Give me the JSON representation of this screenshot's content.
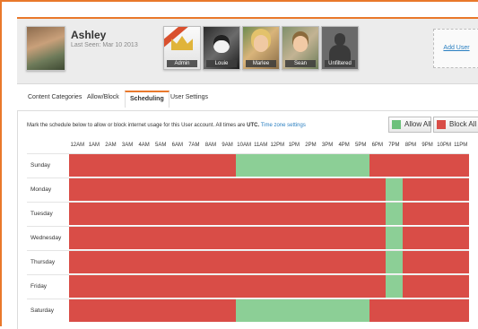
{
  "user": {
    "name": "Ashley",
    "last_seen": "Last Seen: Mar 10 2013"
  },
  "profiles": [
    {
      "label": "Admin",
      "icon": "crown-icon"
    },
    {
      "label": "Louie",
      "icon": "dog-avatar"
    },
    {
      "label": "Marlee",
      "icon": "girl-avatar"
    },
    {
      "label": "Sean",
      "icon": "boy-avatar"
    },
    {
      "label": "Unfiltered",
      "icon": "silhouette-avatar"
    }
  ],
  "add_user_label": "Add User",
  "tabs": [
    {
      "label": "Content Categories",
      "active": false
    },
    {
      "label": "Allow/Block",
      "active": false
    },
    {
      "label": "Scheduling",
      "active": true
    },
    {
      "label": "User Settings",
      "active": false
    }
  ],
  "instructions": {
    "text": "Mark the schedule below to allow or block internet usage for this User account. All times are ",
    "tz": "UTC.",
    "link": "Time zone settings"
  },
  "buttons": {
    "allow_all": "Allow All",
    "block_all": "Block All"
  },
  "colors": {
    "accent": "#e9782b",
    "blocked": "#d94d47",
    "allowed": "#8ccf96",
    "link": "#2a7fc1"
  },
  "hours": [
    "12AM",
    "1AM",
    "2AM",
    "3AM",
    "4AM",
    "5AM",
    "6AM",
    "7AM",
    "8AM",
    "9AM",
    "10AM",
    "11AM",
    "12PM",
    "1PM",
    "2PM",
    "3PM",
    "4PM",
    "5PM",
    "6PM",
    "7PM",
    "8PM",
    "9PM",
    "10PM",
    "11PM"
  ],
  "schedule": [
    {
      "day": "Sunday",
      "allowed": [
        10,
        11,
        12,
        13,
        14,
        15,
        16,
        17
      ]
    },
    {
      "day": "Monday",
      "allowed": [
        19
      ]
    },
    {
      "day": "Tuesday",
      "allowed": [
        19
      ]
    },
    {
      "day": "Wednesday",
      "allowed": [
        19
      ]
    },
    {
      "day": "Thursday",
      "allowed": [
        19
      ]
    },
    {
      "day": "Friday",
      "allowed": [
        19
      ]
    },
    {
      "day": "Saturday",
      "allowed": [
        10,
        11,
        12,
        13,
        14,
        15,
        16,
        17
      ]
    }
  ]
}
